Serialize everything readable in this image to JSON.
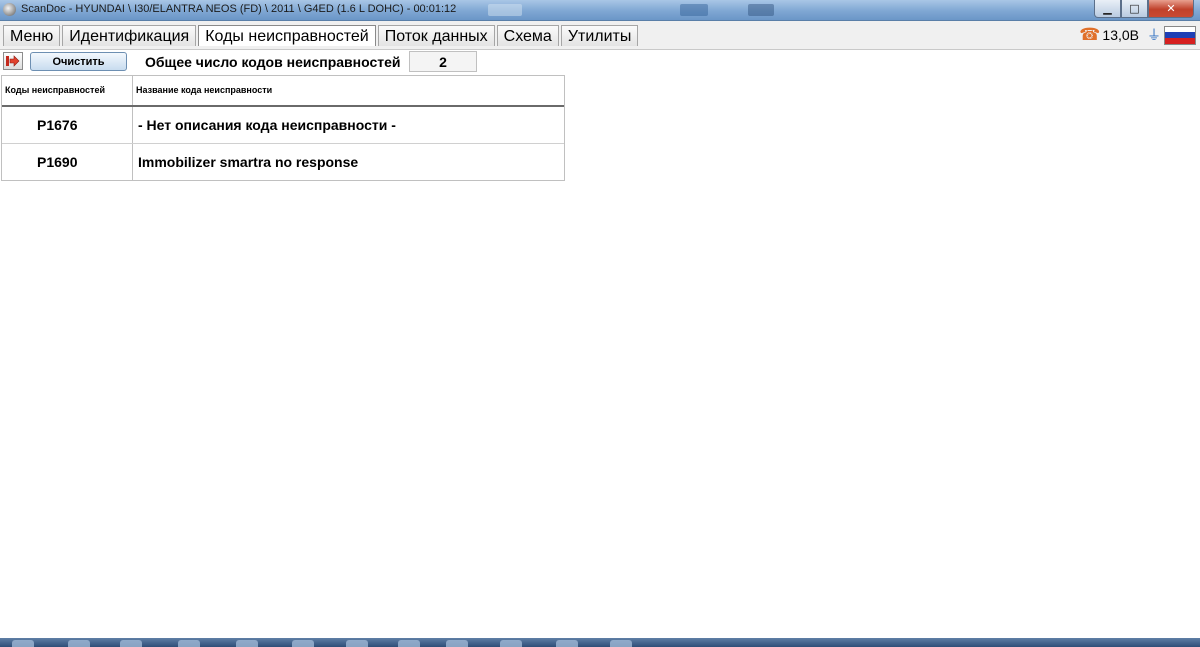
{
  "window": {
    "title": "ScanDoc - HYUNDAI \\ I30/ELANTRA NEOS (FD) \\ 2011 \\ G4ED (1.6 L DOHC) - 00:01:12",
    "controls": {
      "minimize": "▁",
      "maximize": "□",
      "close": "✕"
    }
  },
  "tabs": [
    {
      "label": "Меню"
    },
    {
      "label": "Идентификация"
    },
    {
      "label": "Коды неисправностей",
      "active": true
    },
    {
      "label": "Поток данных"
    },
    {
      "label": "Схема"
    },
    {
      "label": "Утилиты"
    }
  ],
  "status": {
    "voltage": "13,0В",
    "icons": [
      "phone-icon",
      "plug-icon",
      "flag-icon"
    ]
  },
  "toolbar": {
    "clear_label": "Очистить",
    "total_label": "Общее число кодов неисправностей",
    "total_value": "2"
  },
  "table": {
    "headers": [
      "Коды неисправностей",
      "Название кода неисправности"
    ],
    "rows": [
      {
        "code": "P1676",
        "name": "- Нет описания кода неисправности -"
      },
      {
        "code": "P1690",
        "name": "Immobilizer smartra no response"
      }
    ]
  },
  "colors": {
    "accent_orange": "#e0702a",
    "close_red": "#c0412b",
    "flag": [
      "#ffffff",
      "#1f3fb5",
      "#d61f1f"
    ]
  }
}
